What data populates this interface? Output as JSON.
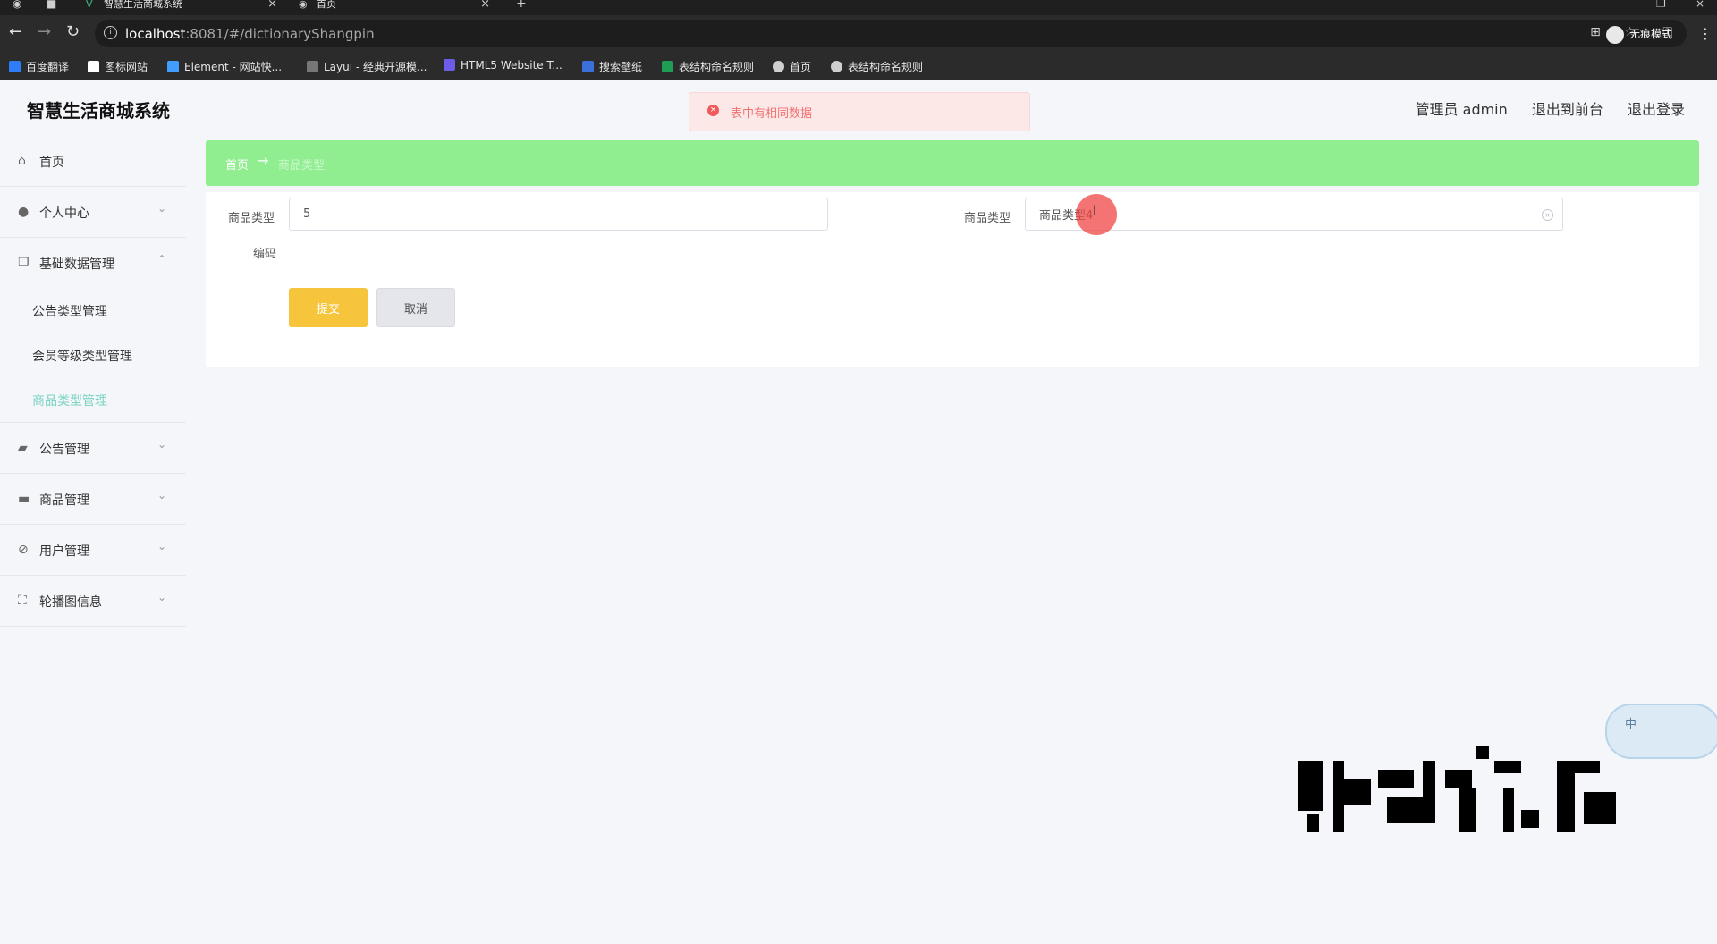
{
  "browser": {
    "tabs": [
      {
        "title": "智慧生活商城系统",
        "active": true
      },
      {
        "title": "首页",
        "active": false
      }
    ],
    "new_tab": "+",
    "url_host": "localhost",
    "url_rest": ":8081/#/dictionaryShangpin",
    "incognito_label": "无痕模式",
    "bookmarks": [
      {
        "label": "百度翻译",
        "color": "#2f7df6"
      },
      {
        "label": "图标网站",
        "color": "#ffffff"
      },
      {
        "label": "Element - 网站快...",
        "color": "#409eff"
      },
      {
        "label": "Layui - 经典开源模...",
        "color": "#cfcfcf"
      },
      {
        "label": "HTML5 Website T...",
        "color": "#6c5ce7"
      },
      {
        "label": "搜索壁纸",
        "color": "#3b6fd9"
      },
      {
        "label": "表结构命名规则",
        "color": "#1f9d55"
      },
      {
        "label": "首页",
        "color": "#cfcfcf"
      },
      {
        "label": "表结构命名规则",
        "color": "#cfcfcf"
      }
    ]
  },
  "app": {
    "title": "智慧生活商城系统",
    "header_links": [
      "管理员 admin",
      "退出到前台",
      "退出登录"
    ],
    "toast": {
      "icon": "×",
      "message": "表中有相同数据"
    },
    "sidebar": {
      "items": [
        {
          "label": "首页",
          "icon": "home-icon",
          "glyph": "⌂"
        },
        {
          "label": "个人中心",
          "icon": "user-icon",
          "glyph": "●",
          "chevron": "⌄"
        },
        {
          "label": "基础数据管理",
          "icon": "copy-icon",
          "glyph": "❐",
          "chevron": "⌃",
          "open": true,
          "children": [
            "公告类型管理",
            "会员等级类型管理",
            "商品类型管理"
          ]
        },
        {
          "label": "公告管理",
          "icon": "announcement-icon",
          "glyph": "▰",
          "chevron": "⌄"
        },
        {
          "label": "商品管理",
          "icon": "monitor-icon",
          "glyph": "▬",
          "chevron": "⌄"
        },
        {
          "label": "用户管理",
          "icon": "user-off-icon",
          "glyph": "⊘",
          "chevron": "⌄"
        },
        {
          "label": "轮播图信息",
          "icon": "fullscreen-icon",
          "glyph": "⛶",
          "chevron": "⌄"
        }
      ],
      "active_child": "商品类型管理"
    },
    "breadcrumb": {
      "home": "首页",
      "arrow": "→",
      "current": "商品类型"
    },
    "form": {
      "code_label_1": "商品类型",
      "code_label_2": "编码",
      "code_value": "5",
      "name_label": "商品类型",
      "name_value": "商品类型4",
      "submit_label": "提交",
      "cancel_label": "取消"
    },
    "float_widget_char": "中"
  },
  "colors": {
    "breadcrumb_bg": "#90ee90",
    "submit_bg": "#f7c53c",
    "active_menu": "#7ad3c2",
    "toast_bg": "#fde8e8",
    "toast_text": "#f07070"
  }
}
